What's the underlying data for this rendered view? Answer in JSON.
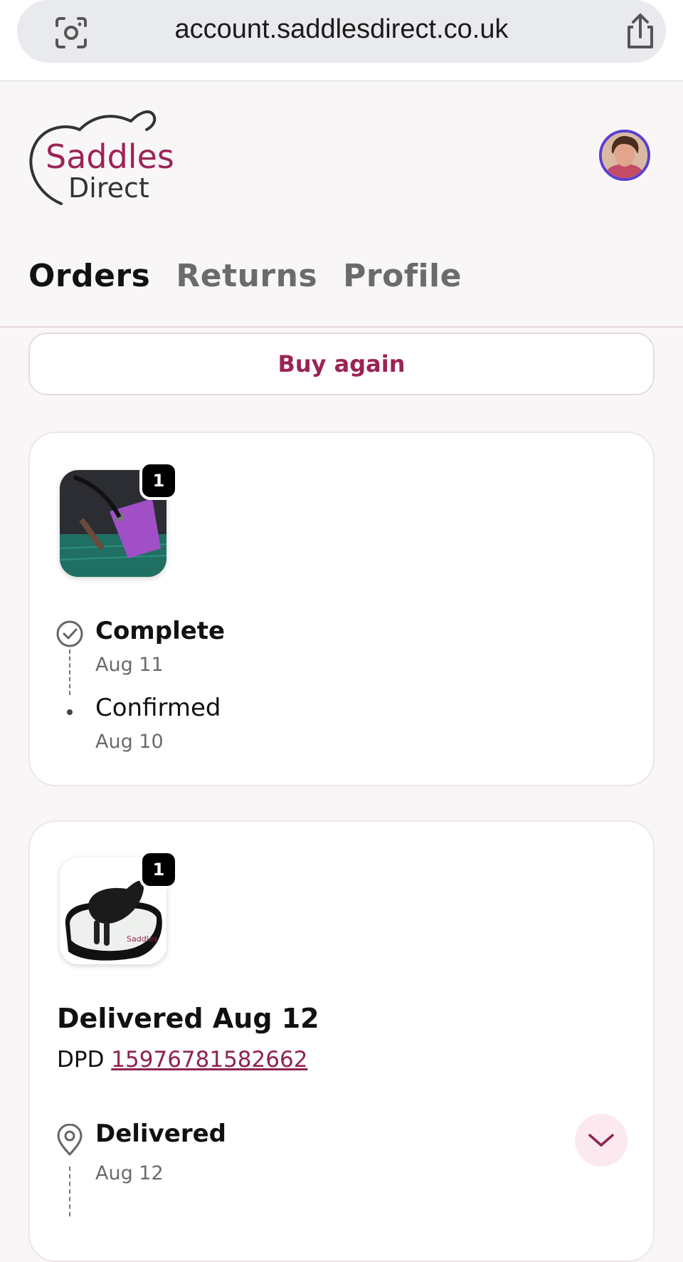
{
  "browser": {
    "url": "account.saddlesdirect.co.uk",
    "icons": {
      "left": "camera-scan-icon",
      "right": "share-icon"
    }
  },
  "header": {
    "logo": {
      "line1": "Saddles",
      "line2": "Direct"
    },
    "avatar_alt": "user-avatar"
  },
  "tabs": [
    {
      "label": "Orders",
      "active": true
    },
    {
      "label": "Returns",
      "active": false
    },
    {
      "label": "Profile",
      "active": false
    }
  ],
  "buy_again_label": "Buy again",
  "orders": [
    {
      "quantity": "1",
      "timeline": [
        {
          "status": "Complete",
          "date": "Aug 11",
          "icon": "check-circle-icon"
        },
        {
          "status": "Confirmed",
          "date": "Aug 10",
          "icon": "dot-icon"
        }
      ]
    },
    {
      "quantity": "1",
      "headline": "Delivered Aug 12",
      "carrier": "DPD",
      "tracking_number": "15976781582662",
      "timeline": [
        {
          "status": "Delivered",
          "date": "Aug 12",
          "icon": "location-pin-icon"
        }
      ],
      "expand_icon": "chevron-down-icon"
    }
  ],
  "colors": {
    "brand": "#9b2456",
    "avatar_ring": "#5b3fd0",
    "link": "#8d2452"
  }
}
